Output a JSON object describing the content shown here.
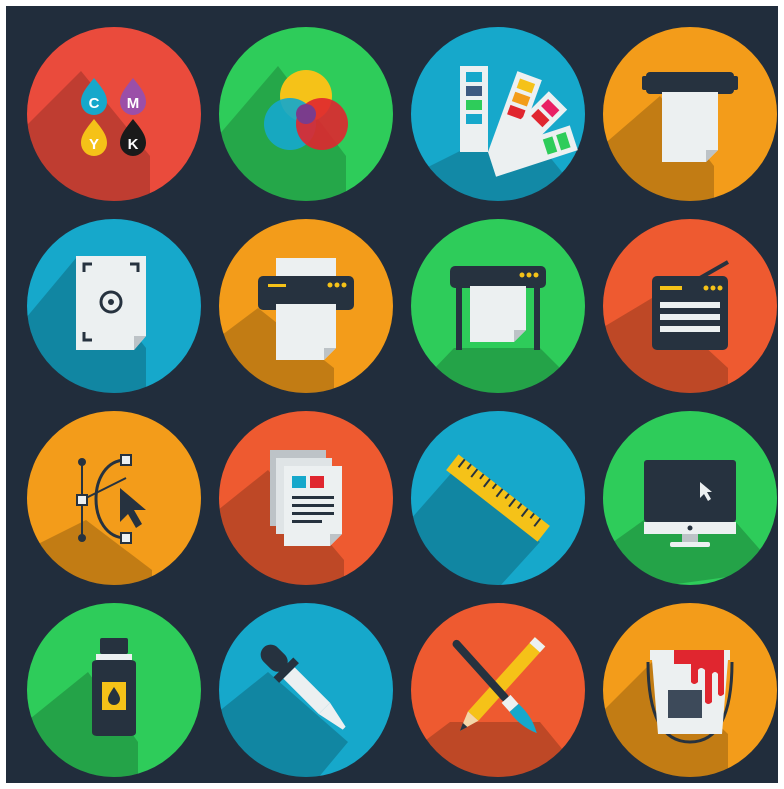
{
  "cmyk": {
    "c": "C",
    "m": "M",
    "y": "Y",
    "k": "K"
  },
  "colors": {
    "background": "#212d3c",
    "red": "#ea4b3c",
    "green": "#2ecc5a",
    "blue": "#16a8cb",
    "orange": "#f39c1a",
    "red_orange": "#ee5a30"
  },
  "icons": [
    "cmyk-drops-icon",
    "color-venn-icon",
    "color-swatches-icon",
    "roll-printer-icon",
    "page-layout-icon",
    "printer-icon",
    "plotter-icon",
    "radio-device-icon",
    "bezier-pen-tool-icon",
    "documents-icon",
    "ruler-icon",
    "desktop-monitor-icon",
    "ink-bottle-icon",
    "eyedropper-icon",
    "pencil-brush-icon",
    "paint-bucket-icon"
  ]
}
